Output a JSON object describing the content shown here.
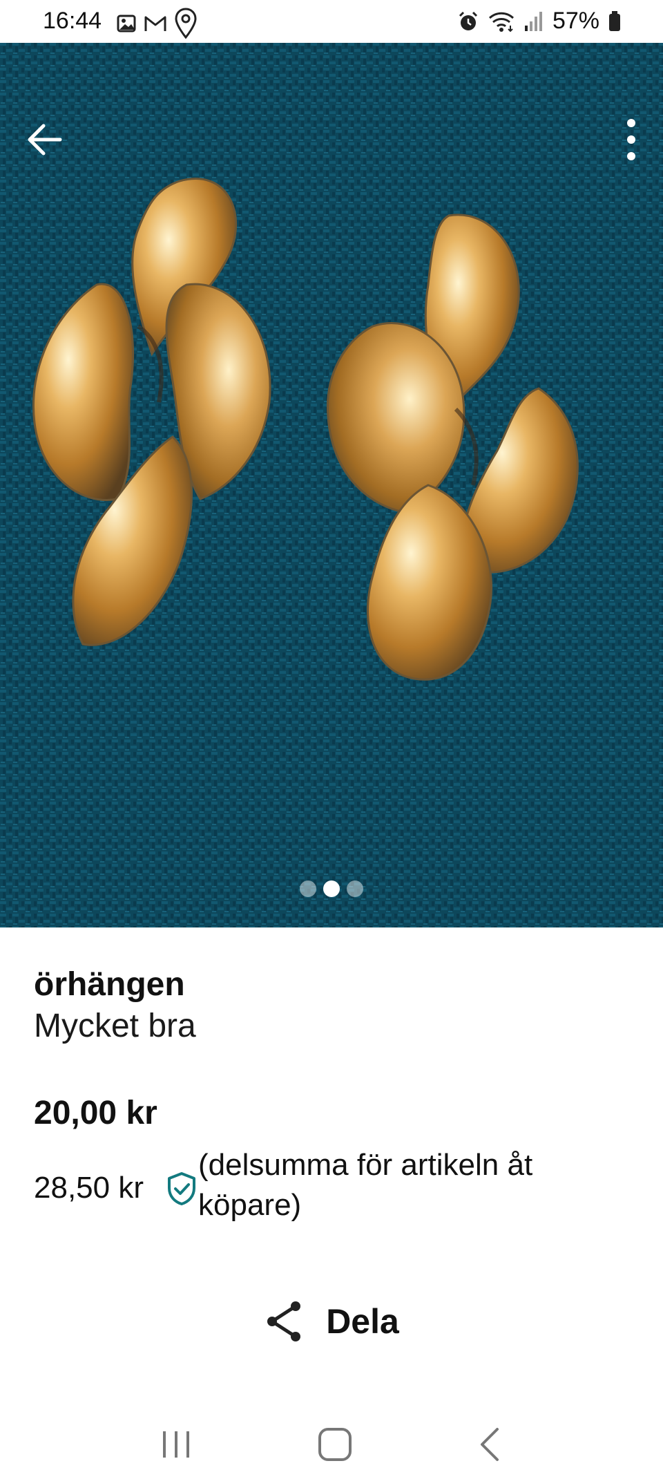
{
  "status_bar": {
    "time": "16:44",
    "battery": "57%",
    "icons": [
      "gallery-icon",
      "gmail-icon",
      "location-icon",
      "alarm-icon",
      "wifi-icon",
      "signal-icon",
      "battery-icon"
    ]
  },
  "gallery": {
    "page_count": 3,
    "active_index": 1
  },
  "product": {
    "title": "örhängen",
    "condition": "Mycket bra",
    "price": "20,00 kr",
    "buyer_price": "28,50 kr",
    "buyer_note": "(delsumma för artikeln åt köpare)"
  },
  "share": {
    "label": "Dela"
  },
  "colors": {
    "accent": "#137a7f",
    "text": "#111111",
    "fabric": "#0f4b5f"
  }
}
